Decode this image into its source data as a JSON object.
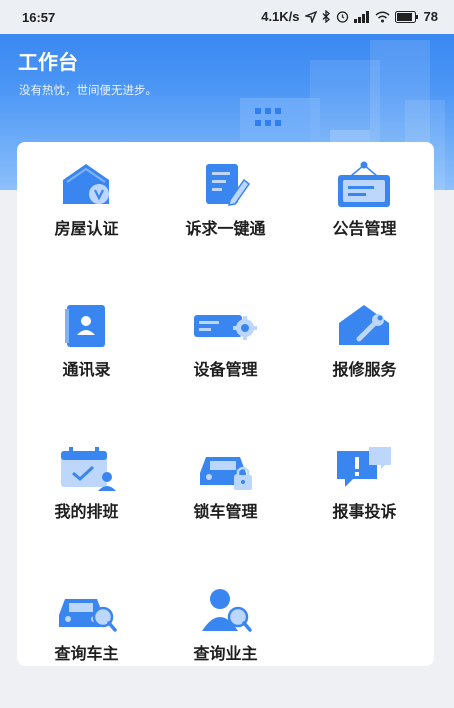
{
  "status_bar": {
    "time": "16:57",
    "network_speed": "4.1K/s",
    "battery": "78"
  },
  "header": {
    "title": "工作台",
    "subtitle": "没有热忱，世间便无进步。"
  },
  "grid": {
    "items": [
      {
        "label": "房屋认证",
        "icon": "house-verify-icon"
      },
      {
        "label": "诉求一键通",
        "icon": "document-edit-icon"
      },
      {
        "label": "公告管理",
        "icon": "notice-board-icon"
      },
      {
        "label": "通讯录",
        "icon": "contacts-book-icon"
      },
      {
        "label": "设备管理",
        "icon": "device-card-gear-icon"
      },
      {
        "label": "报修服务",
        "icon": "house-wrench-icon"
      },
      {
        "label": "我的排班",
        "icon": "calendar-schedule-icon"
      },
      {
        "label": "锁车管理",
        "icon": "car-lock-icon"
      },
      {
        "label": "报事投诉",
        "icon": "message-alert-icon"
      },
      {
        "label": "查询车主",
        "icon": "car-search-icon"
      },
      {
        "label": "查询业主",
        "icon": "person-search-icon"
      }
    ]
  },
  "colors": {
    "accent": "#2f7ff0",
    "icon_primary": "#3a86f0",
    "icon_light": "#bcd7fb"
  }
}
